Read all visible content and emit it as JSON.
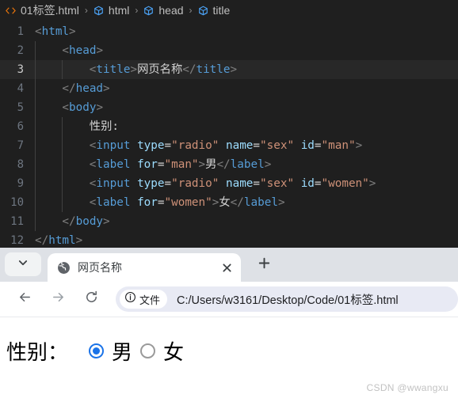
{
  "editor": {
    "breadcrumb": {
      "file_icon": "code-tags-icon",
      "file_name": "01标签.html",
      "separator": "›",
      "items": [
        {
          "icon": "symbol-cube-icon",
          "label": "html"
        },
        {
          "icon": "symbol-cube-icon",
          "label": "head"
        },
        {
          "icon": "symbol-cube-icon",
          "label": "title"
        }
      ]
    },
    "active_line": 3,
    "lines": [
      {
        "num": "1",
        "indent": 0,
        "tokens": [
          {
            "t": "br",
            "v": "<"
          },
          {
            "t": "tag",
            "v": "html"
          },
          {
            "t": "br",
            "v": ">"
          }
        ]
      },
      {
        "num": "2",
        "indent": 1,
        "tokens": [
          {
            "t": "br",
            "v": "<"
          },
          {
            "t": "tag",
            "v": "head"
          },
          {
            "t": "br",
            "v": ">"
          }
        ]
      },
      {
        "num": "3",
        "indent": 2,
        "tokens": [
          {
            "t": "br",
            "v": "<"
          },
          {
            "t": "tag",
            "v": "title"
          },
          {
            "t": "br",
            "v": ">"
          },
          {
            "t": "txt",
            "v": "网页名称"
          },
          {
            "t": "br",
            "v": "</"
          },
          {
            "t": "tag",
            "v": "title"
          },
          {
            "t": "br",
            "v": ">"
          }
        ]
      },
      {
        "num": "4",
        "indent": 1,
        "tokens": [
          {
            "t": "br",
            "v": "</"
          },
          {
            "t": "tag",
            "v": "head"
          },
          {
            "t": "br",
            "v": ">"
          }
        ]
      },
      {
        "num": "5",
        "indent": 1,
        "tokens": [
          {
            "t": "br",
            "v": "<"
          },
          {
            "t": "tag",
            "v": "body"
          },
          {
            "t": "br",
            "v": ">"
          }
        ]
      },
      {
        "num": "6",
        "indent": 2,
        "tokens": [
          {
            "t": "txt",
            "v": "性别:"
          }
        ]
      },
      {
        "num": "7",
        "indent": 2,
        "tokens": [
          {
            "t": "br",
            "v": "<"
          },
          {
            "t": "tag",
            "v": "input"
          },
          {
            "t": "eq",
            "v": " "
          },
          {
            "t": "attr",
            "v": "type"
          },
          {
            "t": "eq",
            "v": "="
          },
          {
            "t": "str",
            "v": "\"radio\""
          },
          {
            "t": "eq",
            "v": " "
          },
          {
            "t": "attr",
            "v": "name"
          },
          {
            "t": "eq",
            "v": "="
          },
          {
            "t": "str",
            "v": "\"sex\""
          },
          {
            "t": "eq",
            "v": " "
          },
          {
            "t": "attr",
            "v": "id"
          },
          {
            "t": "eq",
            "v": "="
          },
          {
            "t": "str",
            "v": "\"man\""
          },
          {
            "t": "br",
            "v": ">"
          }
        ]
      },
      {
        "num": "8",
        "indent": 2,
        "tokens": [
          {
            "t": "br",
            "v": "<"
          },
          {
            "t": "tag",
            "v": "label"
          },
          {
            "t": "eq",
            "v": " "
          },
          {
            "t": "attr",
            "v": "for"
          },
          {
            "t": "eq",
            "v": "="
          },
          {
            "t": "str",
            "v": "\"man\""
          },
          {
            "t": "br",
            "v": ">"
          },
          {
            "t": "txt",
            "v": "男"
          },
          {
            "t": "br",
            "v": "</"
          },
          {
            "t": "tag",
            "v": "label"
          },
          {
            "t": "br",
            "v": ">"
          }
        ]
      },
      {
        "num": "9",
        "indent": 2,
        "tokens": [
          {
            "t": "br",
            "v": "<"
          },
          {
            "t": "tag",
            "v": "input"
          },
          {
            "t": "eq",
            "v": " "
          },
          {
            "t": "attr",
            "v": "type"
          },
          {
            "t": "eq",
            "v": "="
          },
          {
            "t": "str",
            "v": "\"radio\""
          },
          {
            "t": "eq",
            "v": " "
          },
          {
            "t": "attr",
            "v": "name"
          },
          {
            "t": "eq",
            "v": "="
          },
          {
            "t": "str",
            "v": "\"sex\""
          },
          {
            "t": "eq",
            "v": " "
          },
          {
            "t": "attr",
            "v": "id"
          },
          {
            "t": "eq",
            "v": "="
          },
          {
            "t": "str",
            "v": "\"women\""
          },
          {
            "t": "br",
            "v": ">"
          }
        ]
      },
      {
        "num": "10",
        "indent": 2,
        "tokens": [
          {
            "t": "br",
            "v": "<"
          },
          {
            "t": "tag",
            "v": "label"
          },
          {
            "t": "eq",
            "v": " "
          },
          {
            "t": "attr",
            "v": "for"
          },
          {
            "t": "eq",
            "v": "="
          },
          {
            "t": "str",
            "v": "\"women\""
          },
          {
            "t": "br",
            "v": ">"
          },
          {
            "t": "txt",
            "v": "女"
          },
          {
            "t": "br",
            "v": "</"
          },
          {
            "t": "tag",
            "v": "label"
          },
          {
            "t": "br",
            "v": ">"
          }
        ]
      },
      {
        "num": "11",
        "indent": 1,
        "tokens": [
          {
            "t": "br",
            "v": "</"
          },
          {
            "t": "tag",
            "v": "body"
          },
          {
            "t": "br",
            "v": ">"
          }
        ]
      },
      {
        "num": "12",
        "indent": 0,
        "tokens": [
          {
            "t": "br",
            "v": "</"
          },
          {
            "t": "tag",
            "v": "html"
          },
          {
            "t": "br",
            "v": ">"
          }
        ]
      }
    ],
    "colors": {
      "background": "#1f1f1f",
      "active_line": "#282828",
      "tag": "#569cd6",
      "attribute": "#9cdcfe",
      "string": "#ce9178",
      "bracket": "#808080",
      "text": "#d4d4d4",
      "line_number": "#6e7681"
    }
  },
  "browser": {
    "tab_search_icon": "chevron-down-icon",
    "tab": {
      "favicon": "globe-icon",
      "title": "网页名称",
      "close_icon": "close-icon"
    },
    "new_tab_icon": "plus-icon",
    "toolbar": {
      "back_icon": "arrow-left-icon",
      "forward_icon": "arrow-right-icon",
      "reload_icon": "reload-icon"
    },
    "omnibox": {
      "security_icon": "info-circle-icon",
      "security_label": "文件",
      "url": "C:/Users/w3161/Desktop/Code/01标签.html",
      "url_visible": "C:/Users/w3161/Desktop/Code/01标签.ht"
    },
    "colors": {
      "tabstrip": "#dee1e6",
      "active_tab": "#ffffff",
      "omnibox": "#e8eaf4",
      "accent": "#1a73e8"
    }
  },
  "page": {
    "gender_label": "性别：",
    "options": [
      {
        "id": "man",
        "label": "男",
        "checked": true
      },
      {
        "id": "women",
        "label": "女",
        "checked": false
      }
    ]
  },
  "watermark": "CSDN @wwangxu"
}
